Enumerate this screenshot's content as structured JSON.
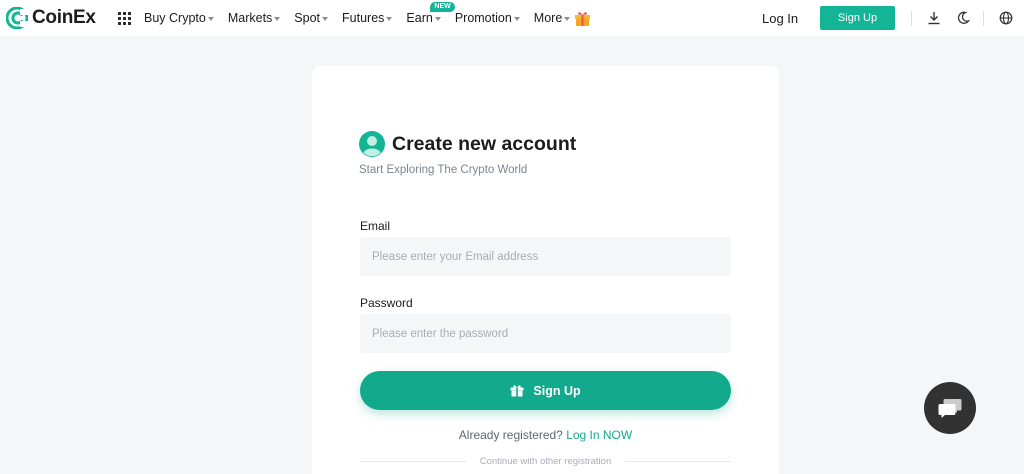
{
  "nav": {
    "brand": "CoinEx",
    "menu": [
      {
        "label": "Buy Crypto",
        "caret": true
      },
      {
        "label": "Markets",
        "caret": true
      },
      {
        "label": "Spot",
        "caret": true
      },
      {
        "label": "Futures",
        "caret": true
      },
      {
        "label": "Earn",
        "caret": true,
        "badge": "NEW"
      },
      {
        "label": "Promotion",
        "caret": true
      },
      {
        "label": "More",
        "caret": true
      }
    ],
    "login": "Log In",
    "signup": "Sign Up",
    "icons": [
      "gift-icon",
      "download-icon",
      "moon-icon",
      "globe-icon"
    ]
  },
  "form": {
    "title": "Create new account",
    "subtitle": "Start Exploring The Crypto World",
    "email_label": "Email",
    "email_placeholder": "Please enter your Email address",
    "email_value": "",
    "password_label": "Password",
    "password_placeholder": "Please enter the password",
    "password_value": "",
    "submit_label": "Sign Up",
    "already_text": "Already registered?",
    "login_now": "Log In NOW",
    "continue_text": "Continue with other registration"
  },
  "colors": {
    "accent": "#13b596",
    "button": "#13a98c",
    "background": "#f5f6f8",
    "chat_bg": "#323232"
  }
}
